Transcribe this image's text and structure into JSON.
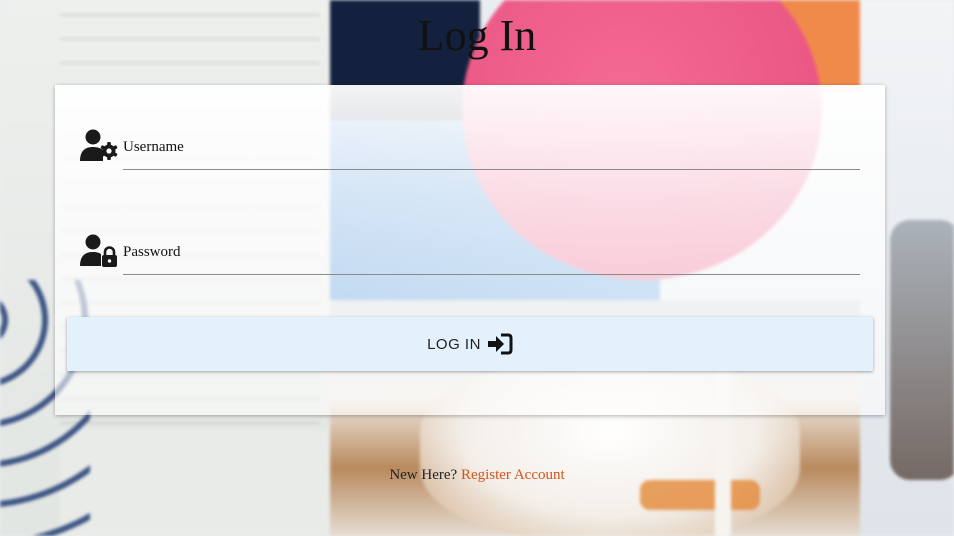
{
  "page": {
    "title": "Log In"
  },
  "form": {
    "username": {
      "label": "Username",
      "value": ""
    },
    "password": {
      "label": "Password",
      "value": ""
    },
    "submit_label": "LOG IN"
  },
  "icons": {
    "username": "user-gear-icon",
    "password": "user-lock-icon",
    "submit": "sign-in-arrow-icon"
  },
  "footer": {
    "prompt": "New Here?",
    "register_link": "Register Account"
  },
  "colors": {
    "button_bg": "#e3f1fd",
    "link": "#d4541c",
    "text": "#111111"
  }
}
